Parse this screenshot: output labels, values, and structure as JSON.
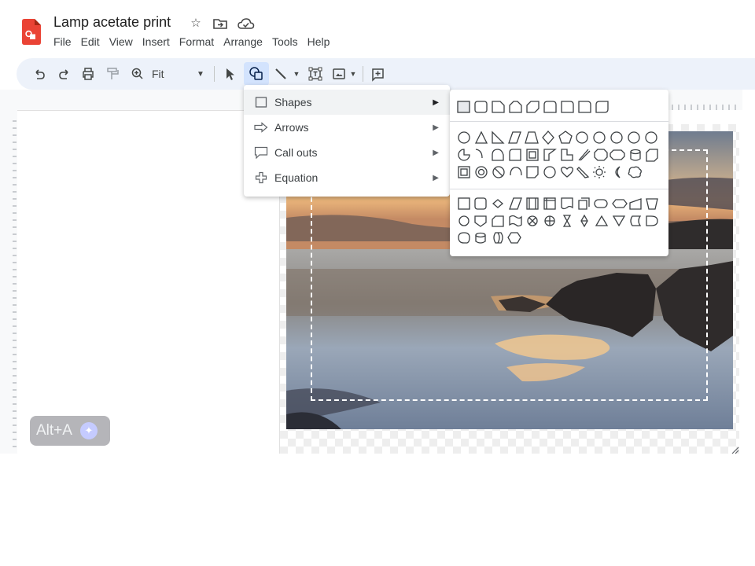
{
  "document": {
    "title": "Lamp acetate print"
  },
  "header_icons": [
    "star-icon",
    "move-to-folder-icon",
    "cloud-saved-icon"
  ],
  "menubar": {
    "items": [
      "File",
      "Edit",
      "View",
      "Insert",
      "Format",
      "Arrange",
      "Tools",
      "Help"
    ]
  },
  "toolbar": {
    "zoom_value": "Fit",
    "icons": [
      "undo-icon",
      "redo-icon",
      "print-icon",
      "paint-format-icon",
      "zoom-icon",
      "select-icon",
      "shape-icon",
      "line-icon",
      "text-box-icon",
      "image-icon",
      "comment-icon"
    ],
    "active_tool": "shape-icon"
  },
  "insert_menu": {
    "items": [
      {
        "label": "Shapes",
        "icon": "square-outline-icon"
      },
      {
        "label": "Arrows",
        "icon": "arrow-outline-icon"
      },
      {
        "label": "Call outs",
        "icon": "callout-icon"
      },
      {
        "label": "Equation",
        "icon": "plus-outline-icon"
      }
    ],
    "highlighted": "Shapes"
  },
  "shapes_submenu": {
    "sections": [
      "Shapes",
      "Flowchart"
    ]
  },
  "canvas": {
    "image_description_hidden": true
  },
  "alt_badge": {
    "label": "Alt+A"
  },
  "colors": {
    "accent": "#d3e3fd",
    "toolbar_bg": "#edf2fa",
    "logo": "#ea4335"
  }
}
